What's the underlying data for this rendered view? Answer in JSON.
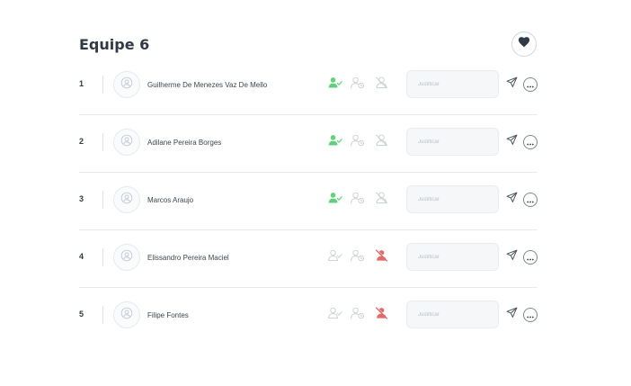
{
  "team": {
    "title": "Equipe 6"
  },
  "colors": {
    "present": "#5cd27a",
    "absent": "#e46a6a",
    "inactive": "#c9cfd4",
    "text": "#2f3a44"
  },
  "icons": {
    "favorite": "heart-icon",
    "avatar": "user-circle-icon",
    "present": "user-check-icon",
    "late": "user-clock-icon",
    "absent": "user-off-icon",
    "send": "send-icon",
    "more": "more-horizontal-icon"
  },
  "members": [
    {
      "number": "1",
      "name": "Guilherme De Menezes Vaz De Mello",
      "status": "present",
      "justify_placeholder": "Justificar"
    },
    {
      "number": "2",
      "name": "Adilane Pereira Borges",
      "status": "present",
      "justify_placeholder": "Justificar"
    },
    {
      "number": "3",
      "name": "Marcos Araujo",
      "status": "present",
      "justify_placeholder": "Justificar"
    },
    {
      "number": "4",
      "name": "Elissandro Pereira Maciel",
      "status": "absent",
      "justify_placeholder": "Justificar"
    },
    {
      "number": "5",
      "name": "Filipe Fontes",
      "status": "absent",
      "justify_placeholder": "Justificar"
    }
  ]
}
